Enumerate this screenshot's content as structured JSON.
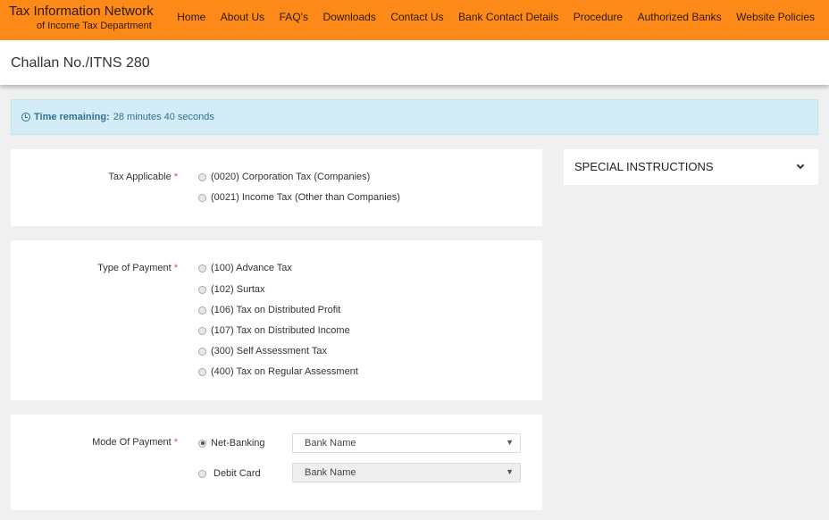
{
  "header": {
    "brand_title": "Tax Information Network",
    "brand_subtitle": "of Income Tax Department",
    "nav": [
      "Home",
      "About Us",
      "FAQ's",
      "Downloads",
      "Contact Us",
      "Bank Contact Details",
      "Procedure",
      "Authorized Banks",
      "Website Policies"
    ]
  },
  "page": {
    "title": "Challan No./ITNS 280"
  },
  "alert": {
    "icon": "clock-icon",
    "label": "Time remaining:",
    "value": "28 minutes 40 seconds"
  },
  "tax_applicable": {
    "label": "Tax Applicable",
    "required_mark": "*",
    "options": [
      {
        "label": "(0020) Corporation Tax (Companies)",
        "checked": false
      },
      {
        "label": "(0021) Income Tax (Other than Companies)",
        "checked": false
      }
    ]
  },
  "type_of_payment": {
    "label": "Type of Payment",
    "required_mark": "*",
    "options": [
      {
        "label": "(100) Advance Tax",
        "checked": false
      },
      {
        "label": "(102) Surtax",
        "checked": false
      },
      {
        "label": "(106) Tax on Distributed Profit",
        "checked": false
      },
      {
        "label": "(107) Tax on Distributed Income",
        "checked": false
      },
      {
        "label": "(300) Self Assessment Tax",
        "checked": false
      },
      {
        "label": "(400) Tax on Regular Assessment",
        "checked": false
      }
    ]
  },
  "mode_of_payment": {
    "label": "Mode Of Payment",
    "required_mark": "*",
    "options": [
      {
        "label": "Net-Banking",
        "checked": true,
        "select_value": "Bank Name",
        "select_disabled": false
      },
      {
        "label": "Debit Card",
        "checked": false,
        "select_value": "Bank Name",
        "select_disabled": true
      }
    ],
    "arrow": "▼"
  },
  "side_panel": {
    "title": "SPECIAL INSTRUCTIONS",
    "icon": "chevron-down-icon"
  }
}
